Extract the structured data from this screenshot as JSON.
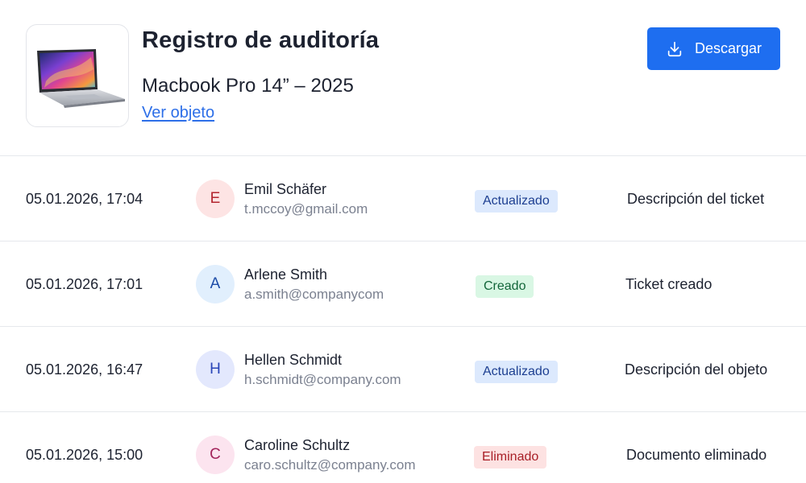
{
  "header": {
    "title": "Registro de auditoría",
    "item_name": "Macbook Pro 14” – 2025",
    "view_link": "Ver objeto",
    "download_label": "Descargar",
    "accent_color": "#1e6ef0"
  },
  "rows": [
    {
      "datetime": "05.01.2026, 17:04",
      "avatar_letter": "E",
      "name": "Emil Schäfer",
      "email": "t.mccoy@gmail.com",
      "status": "Actualizado",
      "description": "Descripción del ticket",
      "avatar_bg": "#fde4e4",
      "avatar_fg": "#b3262f",
      "badge_bg": "#dce9fd",
      "badge_fg": "#1d3f91"
    },
    {
      "datetime": "05.01.2026, 17:01",
      "avatar_letter": "A",
      "name": "Arlene Smith",
      "email": "a.smith@companycom",
      "status": "Creado",
      "description": "Ticket creado",
      "avatar_bg": "#e1effd",
      "avatar_fg": "#1d4ca8",
      "badge_bg": "#d9f7e4",
      "badge_fg": "#13663a"
    },
    {
      "datetime": "05.01.2026, 16:47",
      "avatar_letter": "H",
      "name": "Hellen Schmidt",
      "email": "h.schmidt@company.com",
      "status": "Actualizado",
      "description": "Descripción del objeto",
      "avatar_bg": "#e3e8fd",
      "avatar_fg": "#2a45b8",
      "badge_bg": "#dce9fd",
      "badge_fg": "#1d3f91"
    },
    {
      "datetime": "05.01.2026, 15:00",
      "avatar_letter": "C",
      "name": "Caroline Schultz",
      "email": "caro.schultz@company.com",
      "status": "Eliminado",
      "description": "Documento eliminado",
      "avatar_bg": "#fce4ef",
      "avatar_fg": "#a3245b",
      "badge_bg": "#fde2e2",
      "badge_fg": "#a81e26"
    }
  ]
}
